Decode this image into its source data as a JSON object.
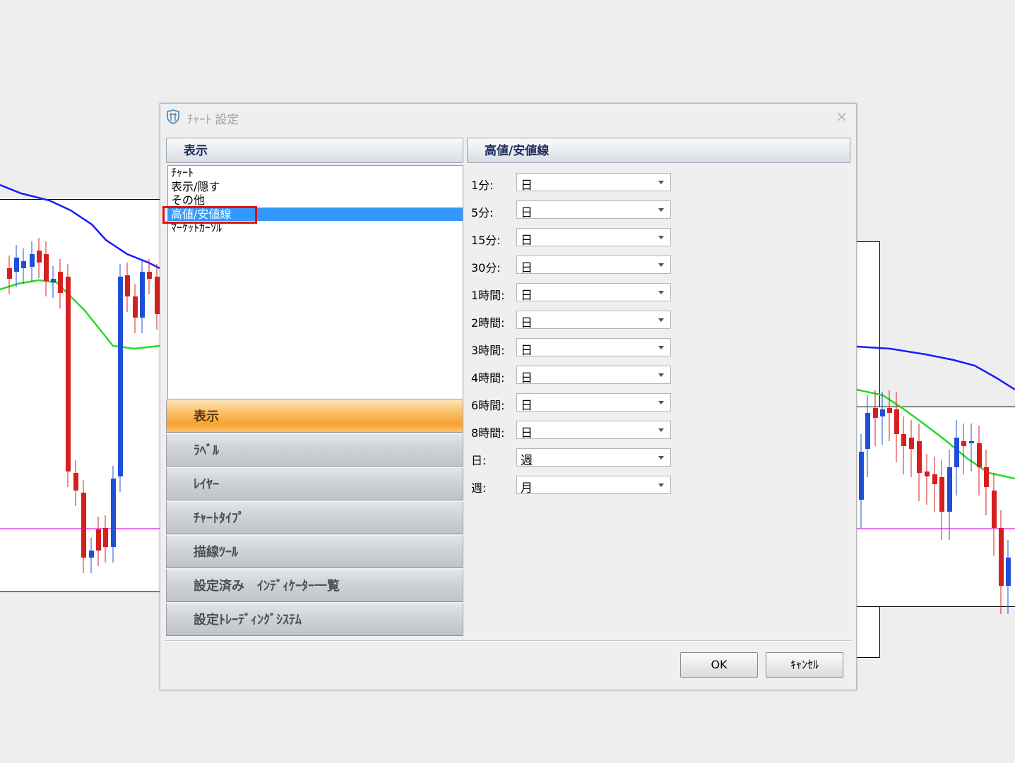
{
  "dialog": {
    "title": "ﾁｬｰﾄ 設定",
    "close_label": "×",
    "left_header": "表示",
    "right_header": "高値/安値線",
    "list_items": [
      {
        "label": "ﾁｬｰﾄ",
        "selected": false
      },
      {
        "label": "表示/隠す",
        "selected": false
      },
      {
        "label": "その他",
        "selected": false
      },
      {
        "label": "高値/安値線",
        "selected": true
      },
      {
        "label": "ﾏｰｹｯﾄｶｰｿﾙ",
        "selected": false
      }
    ],
    "nav_bars": [
      {
        "label": "表示",
        "active": true
      },
      {
        "label": "ﾗﾍﾞﾙ",
        "active": false
      },
      {
        "label": "ﾚｲﾔｰ",
        "active": false
      },
      {
        "label": "ﾁｬｰﾄﾀｲﾌﾟ",
        "active": false
      },
      {
        "label": "描線ﾂｰﾙ",
        "active": false
      },
      {
        "label": "設定済み　ｲﾝﾃﾞｨｹｰﾀｰ一覧",
        "active": false
      },
      {
        "label": "設定ﾄﾚｰﾃﾞｨﾝｸﾞｼｽﾃﾑ",
        "active": false
      }
    ],
    "settings": [
      {
        "label": "1分:",
        "value": "日"
      },
      {
        "label": "5分:",
        "value": "日"
      },
      {
        "label": "15分:",
        "value": "日"
      },
      {
        "label": "30分:",
        "value": "日"
      },
      {
        "label": "1時間:",
        "value": "日"
      },
      {
        "label": "2時間:",
        "value": "日"
      },
      {
        "label": "3時間:",
        "value": "日"
      },
      {
        "label": "4時間:",
        "value": "日"
      },
      {
        "label": "6時間:",
        "value": "日"
      },
      {
        "label": "8時間:",
        "value": "日"
      },
      {
        "label": "日:",
        "value": "週"
      },
      {
        "label": "週:",
        "value": "月"
      }
    ],
    "ok_label": "OK",
    "cancel_label": "ｷｬﾝｾﾙ"
  },
  "colors": {
    "accent_selected": "#3399ff",
    "highlight_box": "#e01010",
    "active_nav": "#f8a233",
    "candle_up": "#1f4fd6",
    "candle_down": "#d61f1f",
    "ma_slow": "#1a1aff",
    "ma_fast": "#22dd22",
    "hline": "#e020e0"
  }
}
